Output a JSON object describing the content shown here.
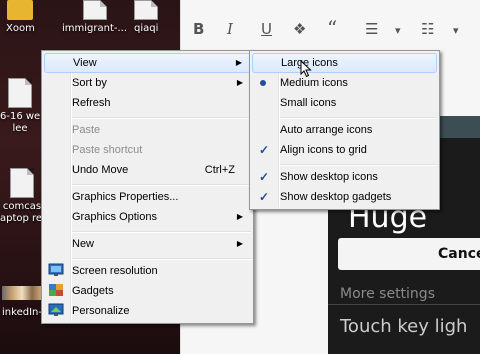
{
  "desktop": {
    "icons": [
      {
        "label": "Xoom",
        "icon": "xoom-folder-icon"
      },
      {
        "label": "immigrant-...",
        "icon": "file-icon"
      },
      {
        "label": "qiaqi",
        "icon": "file-icon"
      },
      {
        "label": "6-16 we",
        "icon": "file-icon"
      },
      {
        "label": "lee",
        "icon": "file-icon"
      },
      {
        "label": "comcas",
        "icon": "file-icon"
      },
      {
        "label": "aptop rep",
        "icon": "file-icon"
      },
      {
        "label": "inkedIn-",
        "icon": "photo-icon"
      }
    ]
  },
  "editor": {
    "toolbar": [
      "B",
      "I",
      "U",
      "❖",
      "“",
      "☰",
      "▾",
      "☷",
      "▾"
    ],
    "phone": {
      "heading": "Huge",
      "cancel": "Cance",
      "more_settings": "More settings",
      "touch_key": "Touch key ligh"
    }
  },
  "context_menu": {
    "items": [
      {
        "label": "View",
        "submenu": true,
        "highlighted": true
      },
      {
        "label": "Sort by",
        "submenu": true
      },
      {
        "label": "Refresh"
      },
      {
        "label": "Paste",
        "disabled": true
      },
      {
        "label": "Paste shortcut",
        "disabled": true
      },
      {
        "label": "Undo Move",
        "accel": "Ctrl+Z"
      },
      {
        "label": "Graphics Properties..."
      },
      {
        "label": "Graphics Options",
        "submenu": true
      },
      {
        "label": "New",
        "submenu": true
      },
      {
        "label": "Screen resolution",
        "icon": "screen-resolution-icon"
      },
      {
        "label": "Gadgets",
        "icon": "gadgets-icon"
      },
      {
        "label": "Personalize",
        "icon": "personalize-icon"
      }
    ]
  },
  "view_submenu": {
    "items": [
      {
        "label": "Large icons",
        "highlighted": true
      },
      {
        "label": "Medium icons",
        "radio": true
      },
      {
        "label": "Small icons"
      },
      {
        "label": "Auto arrange icons"
      },
      {
        "label": "Align icons to grid",
        "checked": true
      },
      {
        "label": "Show desktop icons",
        "checked": true
      },
      {
        "label": "Show desktop gadgets",
        "checked": true
      }
    ]
  }
}
